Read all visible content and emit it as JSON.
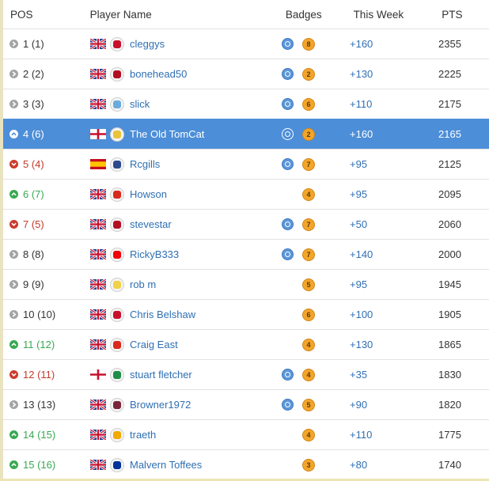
{
  "header": {
    "pos": "POS",
    "player": "Player Name",
    "badges": "Badges",
    "week": "This Week",
    "pts": "PTS"
  },
  "rows": [
    {
      "pos": "1 (1)",
      "trend": "same",
      "flag": "uk",
      "crest": "#c8102e",
      "name": "cleggys",
      "blue_badge": true,
      "badge_num": "8",
      "week": "+160",
      "pts": "2355",
      "highlight": false
    },
    {
      "pos": "2 (2)",
      "trend": "same",
      "flag": "uk",
      "crest": "#b30f23",
      "name": "bonehead50",
      "blue_badge": true,
      "badge_num": "2",
      "week": "+130",
      "pts": "2225",
      "highlight": false
    },
    {
      "pos": "3 (3)",
      "trend": "same",
      "flag": "uk",
      "crest": "#6cabdd",
      "name": "slick",
      "blue_badge": true,
      "badge_num": "6",
      "week": "+110",
      "pts": "2175",
      "highlight": false
    },
    {
      "pos": "4 (6)",
      "trend": "up",
      "flag": "england",
      "crest": "#e9c43a",
      "name": "The Old TomCat",
      "blue_badge": true,
      "badge_num": "2",
      "week": "+160",
      "pts": "2165",
      "highlight": true
    },
    {
      "pos": "5 (4)",
      "trend": "down",
      "flag": "spain",
      "crest": "#2c4a8c",
      "name": "Rcgills",
      "blue_badge": true,
      "badge_num": "7",
      "week": "+95",
      "pts": "2125",
      "highlight": false
    },
    {
      "pos": "6 (7)",
      "trend": "up",
      "flag": "uk",
      "crest": "#da291c",
      "name": "Howson",
      "blue_badge": false,
      "badge_num": "4",
      "week": "+95",
      "pts": "2095",
      "highlight": false
    },
    {
      "pos": "7 (5)",
      "trend": "down",
      "flag": "uk",
      "crest": "#b30f23",
      "name": "stevestar",
      "blue_badge": true,
      "badge_num": "7",
      "week": "+50",
      "pts": "2060",
      "highlight": false
    },
    {
      "pos": "8 (8)",
      "trend": "same",
      "flag": "uk",
      "crest": "#ef0107",
      "name": "RickyB333",
      "blue_badge": true,
      "badge_num": "7",
      "week": "+140",
      "pts": "2000",
      "highlight": false
    },
    {
      "pos": "9 (9)",
      "trend": "same",
      "flag": "uk",
      "crest": "#f0d24a",
      "name": "rob m",
      "blue_badge": false,
      "badge_num": "5",
      "week": "+95",
      "pts": "1945",
      "highlight": false
    },
    {
      "pos": "10 (10)",
      "trend": "same",
      "flag": "uk",
      "crest": "#c8102e",
      "name": "Chris Belshaw",
      "blue_badge": false,
      "badge_num": "6",
      "week": "+100",
      "pts": "1905",
      "highlight": false
    },
    {
      "pos": "11 (12)",
      "trend": "up",
      "flag": "uk",
      "crest": "#da291c",
      "name": "Craig East",
      "blue_badge": false,
      "badge_num": "4",
      "week": "+130",
      "pts": "1865",
      "highlight": false
    },
    {
      "pos": "12 (11)",
      "trend": "down",
      "flag": "england",
      "crest": "#1e8e4a",
      "name": "stuart fletcher",
      "blue_badge": true,
      "badge_num": "4",
      "week": "+35",
      "pts": "1830",
      "highlight": false
    },
    {
      "pos": "13 (13)",
      "trend": "same",
      "flag": "uk",
      "crest": "#7a263a",
      "name": "Browner1972",
      "blue_badge": true,
      "badge_num": "5",
      "week": "+90",
      "pts": "1820",
      "highlight": false
    },
    {
      "pos": "14 (15)",
      "trend": "up",
      "flag": "uk",
      "crest": "#f2a900",
      "name": "traeth",
      "blue_badge": false,
      "badge_num": "4",
      "week": "+110",
      "pts": "1775",
      "highlight": false
    },
    {
      "pos": "15 (16)",
      "trend": "up",
      "flag": "uk",
      "crest": "#003399",
      "name": "Malvern Toffees",
      "blue_badge": false,
      "badge_num": "3",
      "week": "+80",
      "pts": "1740",
      "highlight": false
    }
  ]
}
